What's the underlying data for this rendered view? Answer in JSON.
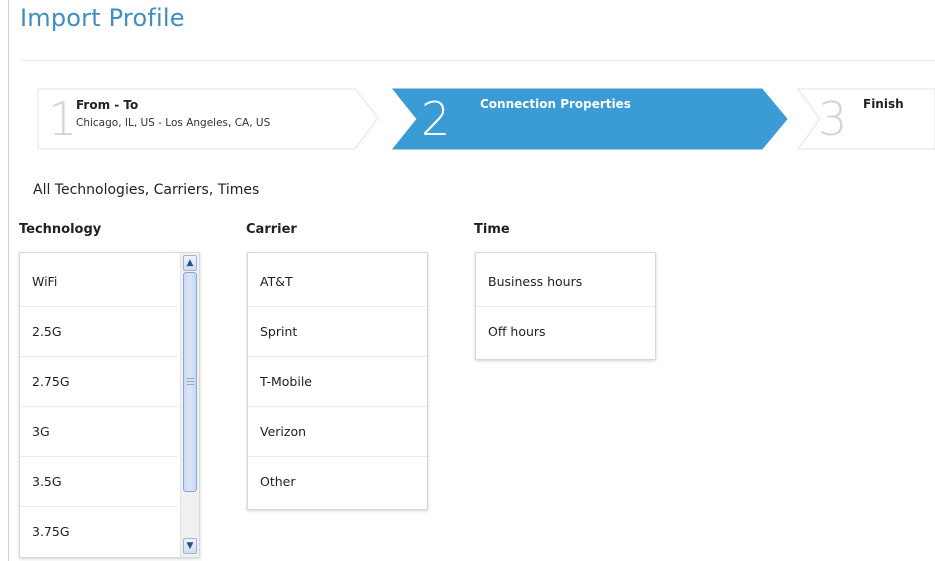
{
  "page": {
    "title": "Import Profile"
  },
  "wizard": {
    "steps": [
      {
        "number": "1",
        "title": "From - To",
        "subtitle": "Chicago, IL, US - Los Angeles, CA, US",
        "state": "done"
      },
      {
        "number": "2",
        "title": "Connection Properties",
        "subtitle": "",
        "state": "active"
      },
      {
        "number": "3",
        "title": "Finish",
        "subtitle": "",
        "state": "pending"
      }
    ],
    "active_color": "#3a9bd5"
  },
  "summary": "All Technologies, Carriers, Times",
  "technology": {
    "heading": "Technology",
    "items": [
      "WiFi",
      "2.5G",
      "2.75G",
      "3G",
      "3.5G",
      "3.75G"
    ]
  },
  "carrier": {
    "heading": "Carrier",
    "items": [
      "AT&T",
      "Sprint",
      "T-Mobile",
      "Verizon",
      "Other"
    ]
  },
  "time": {
    "heading": "Time",
    "items": [
      "Business hours",
      "Off hours"
    ]
  },
  "icons": {
    "scroll_up": "chevron-up-icon",
    "scroll_down": "chevron-down-icon"
  }
}
